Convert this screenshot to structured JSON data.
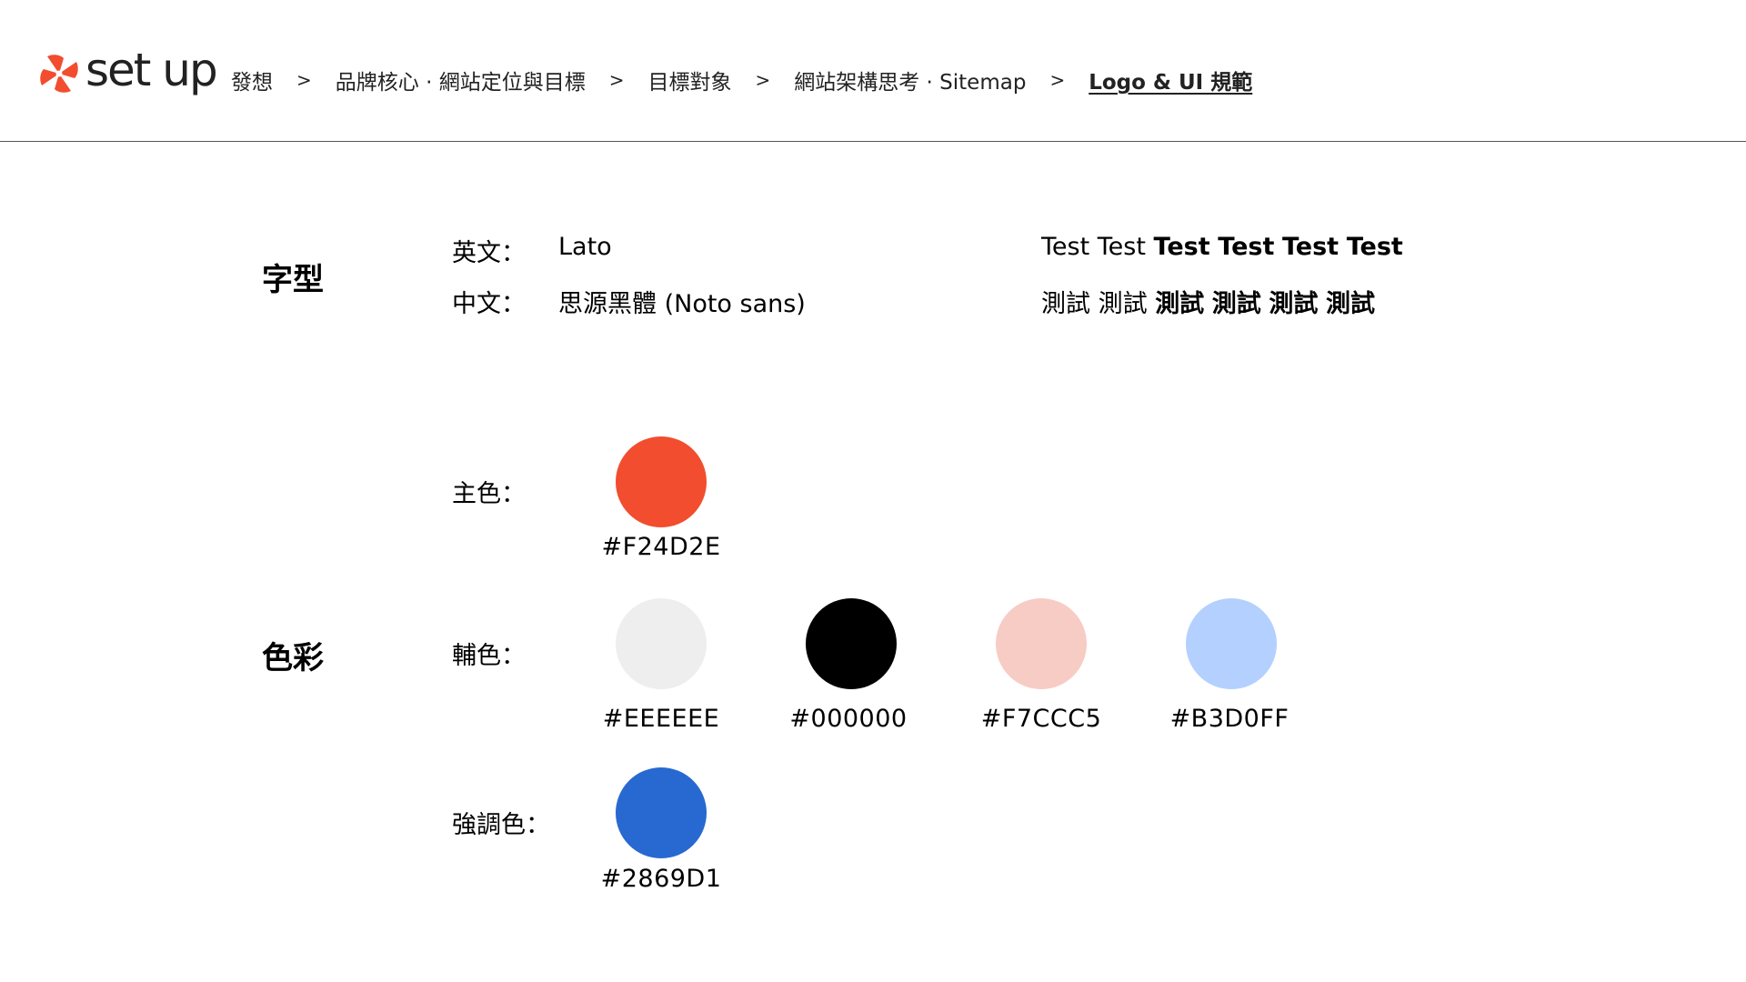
{
  "header": {
    "logo_text": "set up",
    "breadcrumbs": [
      "發想",
      "品牌核心 · 網站定位與目標",
      "目標對象",
      "網站架構思考 · Sitemap",
      "Logo & UI 規範"
    ],
    "separator": ">"
  },
  "typography": {
    "title": "字型",
    "english_label": "英文：",
    "english_font": "Lato",
    "chinese_label": "中文：",
    "chinese_font": "思源黑體 (Noto sans)",
    "english_samples": [
      "Test",
      "Test",
      "Test",
      "Test",
      "Test",
      "Test"
    ],
    "chinese_samples": [
      "測試",
      "測試",
      "測試",
      "測試",
      "測試",
      "測試"
    ]
  },
  "colors": {
    "title": "色彩",
    "primary_label": "主色：",
    "secondary_label": "輔色：",
    "accent_label": "強調色：",
    "primary": [
      {
        "hex": "#F24D2E"
      }
    ],
    "secondary": [
      {
        "hex": "#EEEEEE"
      },
      {
        "hex": "#000000"
      },
      {
        "hex": "#F7CCC5"
      },
      {
        "hex": "#B3D0FF"
      }
    ],
    "accent": [
      {
        "hex": "#2869D1"
      }
    ],
    "brand_logo_color": "#F24D2E"
  }
}
